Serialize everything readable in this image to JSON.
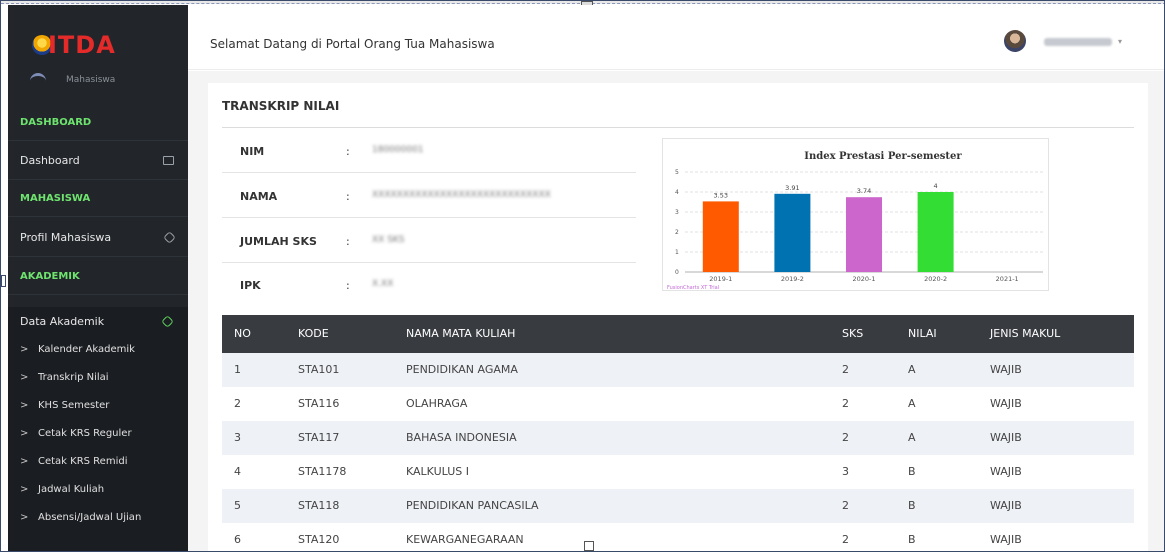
{
  "app": {
    "logo_text": "ITDA",
    "logo_subtitle": "Mahasiswa"
  },
  "sidebar": {
    "sections": {
      "dashboard": "DASHBOARD",
      "mahasiswa": "MAHASISWA",
      "akademik": "AKADEMIK"
    },
    "items": {
      "dashboard": "Dashboard",
      "profil": "Profil Mahasiswa",
      "data_akademik": "Data Akademik"
    },
    "submenu": [
      "Kalender Akademik",
      "Transkrip Nilai",
      "KHS Semester",
      "Cetak KRS Reguler",
      "Cetak KRS Remidi",
      "Jadwal Kuliah",
      "Absensi/Jadwal Ujian"
    ]
  },
  "header": {
    "welcome": "Selamat Datang di Portal Orang Tua Mahasiswa"
  },
  "main": {
    "title": "TRANSKRIP NILAI",
    "info": [
      {
        "label": "NIM",
        "value": "180000001"
      },
      {
        "label": "NAMA",
        "value": "XXXXXXXXXXXXXXXXXXXXXXXXXXXXX"
      },
      {
        "label": "JUMLAH SKS",
        "value": "XX SKS"
      },
      {
        "label": "IPK",
        "value": "X.XX"
      }
    ],
    "table": {
      "headers": [
        "NO",
        "KODE",
        "NAMA MATA KULIAH",
        "SKS",
        "NILAI",
        "JENIS MAKUL"
      ],
      "rows": [
        [
          "1",
          "STA101",
          "PENDIDIKAN AGAMA",
          "2",
          "A",
          "WAJIB"
        ],
        [
          "2",
          "STA116",
          "OLAHRAGA",
          "2",
          "A",
          "WAJIB"
        ],
        [
          "3",
          "STA117",
          "BAHASA INDONESIA",
          "2",
          "A",
          "WAJIB"
        ],
        [
          "4",
          "STA1178",
          "KALKULUS I",
          "3",
          "B",
          "WAJIB"
        ],
        [
          "5",
          "STA118",
          "PENDIDIKAN PANCASILA",
          "2",
          "B",
          "WAJIB"
        ],
        [
          "6",
          "STA120",
          "KEWARGANEGARAAN",
          "2",
          "B",
          "WAJIB"
        ]
      ]
    }
  },
  "chart_data": {
    "type": "bar",
    "title": "Index Prestasi Per-semester",
    "categories": [
      "2019-1",
      "2019-2",
      "2020-1",
      "2020-2",
      "2021-1"
    ],
    "values": [
      3.53,
      3.91,
      3.74,
      4,
      null
    ],
    "value_labels": [
      "3.53",
      "3.91",
      "3.74",
      "4",
      ""
    ],
    "colors": [
      "#ff5a00",
      "#0072b2",
      "#cc66cc",
      "#33dd33",
      "#999999"
    ],
    "ylim": [
      0,
      5
    ],
    "yticks": [
      "0",
      "1",
      "2",
      "3",
      "4",
      "5"
    ],
    "grid": true,
    "credit": "FusionCharts XT Trial"
  }
}
